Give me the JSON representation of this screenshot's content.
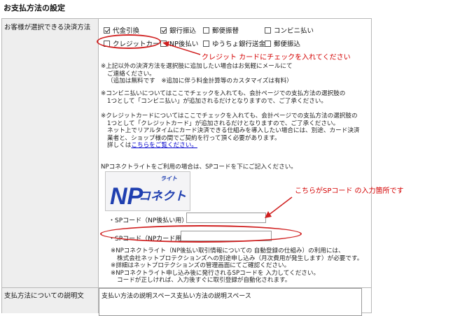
{
  "page_title": "お支払方法の設定",
  "row1_label": "お客様が選択できる決済方法",
  "row2_label": "支払方法についての説明文",
  "methods": [
    {
      "label": "代金引換",
      "checked": true
    },
    {
      "label": "銀行振込",
      "checked": true
    },
    {
      "label": "郵便振替",
      "checked": false
    },
    {
      "label": "コンビニ払い",
      "checked": false
    },
    {
      "label": "クレジットカード",
      "checked": false
    },
    {
      "label": "NP後払い",
      "checked": false
    },
    {
      "label": "ゆうちょ銀行送金",
      "checked": false
    },
    {
      "label": "郵便振込",
      "checked": false
    }
  ],
  "note1": [
    "※上記以外の決済方法を選択肢に追加したい場合はお気軽にメールにて",
    "ご連絡ください。",
    "（追加は無料です　※追加に伴う料金計算等のカスタマイズは有料）"
  ],
  "note2": [
    "※コンビニ払いについてはここでチェックを入れても、会計ページでの支払方法の選択肢の",
    "1つとして「コンビニ払い」が追加されるだけとなりますので、ご了承ください。"
  ],
  "note3": [
    "※クレジットカードについてはここでチェックを入れても、会計ページでの支払方法の選択肢の",
    "1つとして「クレジットカード」が追加されるだけとなりますので、ご了承ください。",
    "ネット上でリアルタイムにカード決済できる仕組みを導入したい場合には、別途、カード決済",
    "業者と、ショップ様の間でご契約を行って頂く必要があります。"
  ],
  "note3_link_prefix": "詳しくは",
  "note3_link": "こちらをご覧ください。",
  "np_intro": "NPコネクトライトをご利用の場合は、SPコードを下にご記入ください。",
  "logo_small": "ライト",
  "logo_main": "コネクト",
  "logo_np": "NP",
  "sp_label1": "・SPコード（NP後払い用）:",
  "sp_value1": "",
  "sp_label2": "・SPコード（NPカード用）:",
  "sp_value2": "",
  "note4": [
    "※NPコネクトライト（NP後払い取引情報についての 自動登録の仕組み）の利用には、",
    "株式会社ネットプロテクションズへの別途申し込み（月次費用が発生します）が必要です。",
    "※詳細はネットプロテクションズの管理画面にてご確認ください。",
    "※NPコネクトライト申し込み後に発行されるSPコードを 入力してください。",
    "コードが正しければ、入力後すぐに取引登録が自動化されます。"
  ],
  "description_text": "支払い方法の説明スペース支払い方法の説明スペース",
  "annotation_credit": "クレジット カードにチェックを入れてください",
  "annotation_sp": "こちらがSPコード の入力箇所です",
  "colors": {
    "annotation": "#d40000",
    "link": "#0000cc",
    "label_bg": "#eeeeee",
    "logo_blue": "#1f3fb0"
  }
}
